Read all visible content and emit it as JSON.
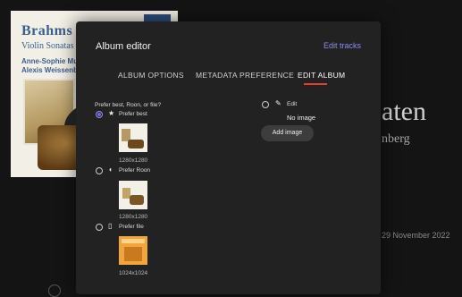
{
  "background": {
    "cover": {
      "title": "Brahms",
      "subtitle": "Violin Sonatas N",
      "artist_line1": "Anne-Sophie Mutt",
      "artist_line2": "Alexis Weissenber"
    },
    "album_title_fragment": "aten",
    "artist_fragment": "nberg",
    "date_fragment": "29 November 2022"
  },
  "modal": {
    "title": "Album editor",
    "edit_tracks": "Edit tracks",
    "tabs": [
      "ALBUM OPTIONS",
      "METADATA PREFERENCE",
      "EDIT ALBUM"
    ],
    "active_tab": "EDIT ALBUM",
    "accent_color": "#8c8cf2",
    "tab_indicator_color": "#e0402e"
  },
  "options": {
    "label": "Prefer best, Roon, or file?",
    "items": [
      {
        "label": "Prefer best",
        "icon": "star-icon",
        "resolution": "1280x1280",
        "checked": true
      },
      {
        "label": "Prefer Roon",
        "icon": "roon-icon",
        "resolution": "1280x1280",
        "checked": false
      },
      {
        "label": "Prefer file",
        "icon": "file-icon",
        "resolution": "1024x1024",
        "checked": false
      }
    ],
    "edit": {
      "label": "Edit",
      "icon": "pencil-icon",
      "checked": false,
      "no_image": "No image",
      "add_image": "Add image"
    }
  }
}
